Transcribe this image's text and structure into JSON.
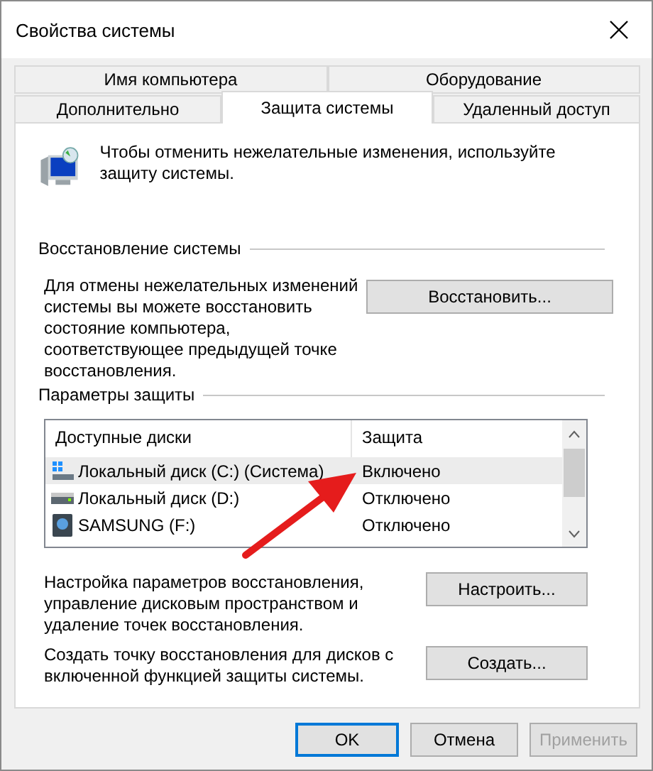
{
  "window": {
    "title": "Свойства системы"
  },
  "tab_rows": [
    [
      {
        "label": "Имя компьютера",
        "selected": false
      },
      {
        "label": "Оборудование",
        "selected": false
      }
    ],
    [
      {
        "label": "Дополнительно",
        "selected": false
      },
      {
        "label": "Защита системы",
        "selected": true
      },
      {
        "label": "Удаленный доступ",
        "selected": false
      }
    ]
  ],
  "intro": "Чтобы отменить нежелательные изменения, используйте защиту системы.",
  "restore": {
    "heading": "Восстановление системы",
    "text": "Для отмены нежелательных изменений системы вы можете восстановить состояние компьютера, соответствующее предыдущей точке восстановления.",
    "button": "Восстановить..."
  },
  "protection": {
    "heading": "Параметры защиты",
    "columns": [
      "Доступные диски",
      "Защита"
    ],
    "disks": [
      {
        "kind": "system",
        "name": "Локальный диск (C:) (Система)",
        "status": "Включено",
        "selected": true
      },
      {
        "kind": "local",
        "name": "Локальный диск (D:)",
        "status": "Отключено",
        "selected": false
      },
      {
        "kind": "external",
        "name": "SAMSUNG (F:)",
        "status": "Отключено",
        "selected": false
      }
    ],
    "configure_text": "Настройка параметров восстановления, управление дисковым пространством и удаление точек восстановления.",
    "configure_button": "Настроить...",
    "create_text": "Создать точку восстановления для дисков с включенной функцией защиты системы.",
    "create_button": "Создать..."
  },
  "buttons": [
    {
      "label": "OK",
      "default": true,
      "disabled": false
    },
    {
      "label": "Отмена",
      "default": false,
      "disabled": false
    },
    {
      "label": "Применить",
      "default": false,
      "disabled": true
    }
  ]
}
